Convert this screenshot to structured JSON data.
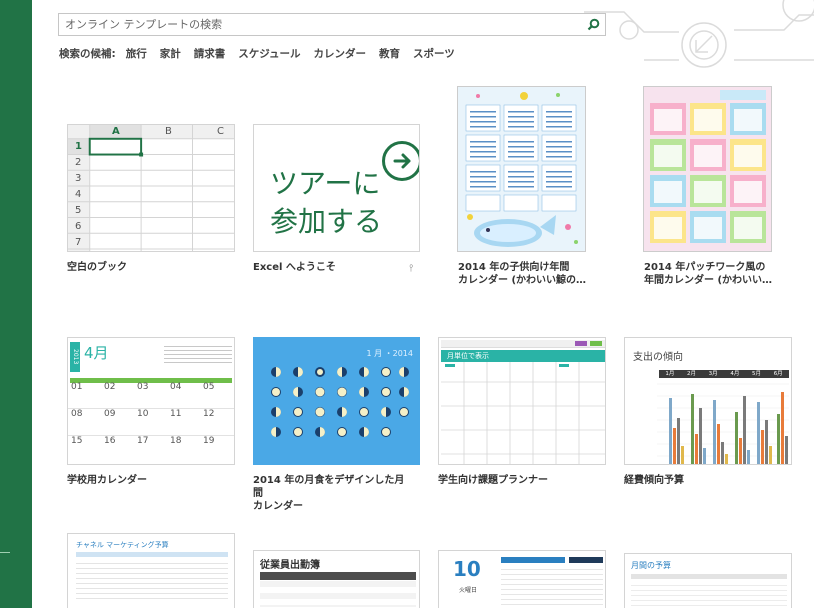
{
  "search": {
    "placeholder": "オンライン テンプレートの検索"
  },
  "suggestions": {
    "label": "検索の候補:",
    "items": [
      "旅行",
      "家計",
      "請求書",
      "スケジュール",
      "カレンダー",
      "教育",
      "スポーツ"
    ]
  },
  "blank_book": {
    "columns": [
      "A",
      "B",
      "C"
    ],
    "rows": [
      "1",
      "2",
      "3",
      "4",
      "5",
      "6",
      "7"
    ]
  },
  "welcome": {
    "line1": "ツアーに",
    "line2": "参加する"
  },
  "school_calendar": {
    "year": "2013",
    "month": "4月",
    "dates_row1": [
      "01",
      "02",
      "03",
      "04",
      "05"
    ],
    "dates_row2": [
      "08",
      "09",
      "10",
      "11",
      "12"
    ],
    "dates_row3": [
      "15",
      "16",
      "17",
      "18",
      "19"
    ]
  },
  "moon_calendar": {
    "header": "1 月 ・2014"
  },
  "planner": {
    "header": "月単位で表示"
  },
  "expense": {
    "title": "支出の傾向",
    "months": [
      "1月",
      "2月",
      "3月",
      "4月",
      "5月",
      "6月"
    ]
  },
  "row3": {
    "marketing_title": "チャネル マーケティング予算",
    "attendance_title": "従業員出勤簿",
    "date_day": "10",
    "date_label": "火曜日",
    "budget_title": "月間の予算"
  },
  "captions": {
    "blank": "空白のブック",
    "welcome": "Excel へようこそ",
    "kids_cal_1": "2014 年の子供向け年間",
    "kids_cal_2": "カレンダー (かわいい鯨の…",
    "patch_cal_1": "2014 年パッチワーク風の",
    "patch_cal_2": "年間カレンダー (かわいい…",
    "school": "学校用カレンダー",
    "moon_1": "2014 年の月食をデザインした月間",
    "moon_2": "カレンダー",
    "planner": "学生向け課題プランナー",
    "expense": "経費傾向予算"
  },
  "colors": {
    "excel_green": "#217346",
    "teal": "#2ab3a6",
    "moon_blue": "#4aa8e6"
  }
}
